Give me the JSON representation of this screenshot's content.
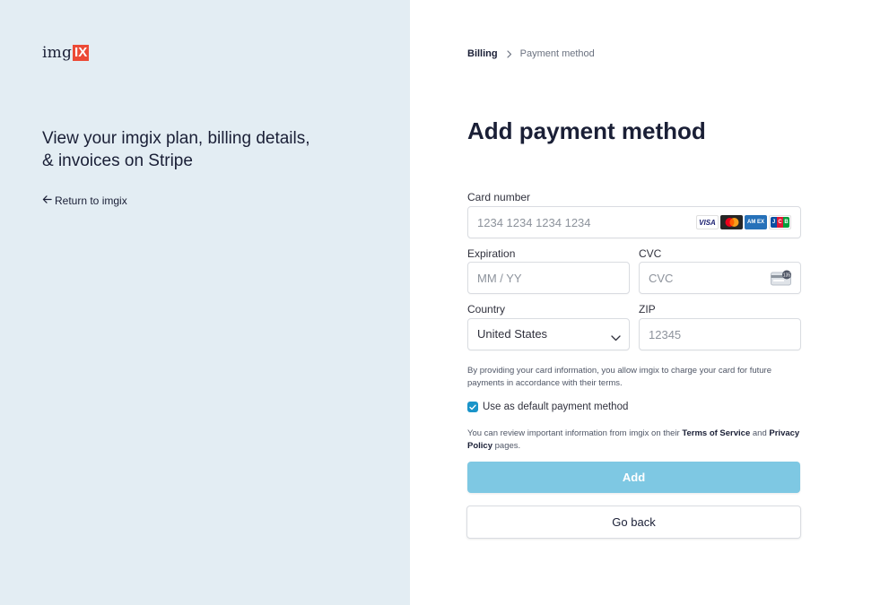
{
  "brand": {
    "logo_prefix": "img",
    "logo_suffix": "IX",
    "logo_accent": "#ec4a36"
  },
  "sidebar": {
    "tagline": "View your imgix plan, billing details, & invoices on Stripe",
    "return_link": "Return to imgix",
    "background": "#e3edf3"
  },
  "breadcrumb": {
    "parent": "Billing",
    "current": "Payment method"
  },
  "page_title": "Add payment method",
  "form": {
    "card_number": {
      "label": "Card number",
      "placeholder": "1234 1234 1234 1234",
      "value": "",
      "brands": [
        "visa",
        "mastercard",
        "amex",
        "jcb"
      ]
    },
    "expiration": {
      "label": "Expiration",
      "placeholder": "MM / YY",
      "value": ""
    },
    "cvc": {
      "label": "CVC",
      "placeholder": "CVC",
      "value": "",
      "icon_text": "135"
    },
    "country": {
      "label": "Country",
      "value": "United States"
    },
    "zip": {
      "label": "ZIP",
      "placeholder": "12345",
      "value": ""
    }
  },
  "consent_text": "By providing your card information, you allow imgix to charge your card for future payments in accordance with their terms.",
  "default_checkbox": {
    "label": "Use as default payment method",
    "checked": true
  },
  "info": {
    "prefix": "You can review important information from imgix on their ",
    "terms": "Terms of Service",
    "and": " and ",
    "privacy": "Privacy Policy",
    "suffix": " pages."
  },
  "buttons": {
    "add": "Add",
    "back": "Go back",
    "add_color": "#7ec8e3"
  }
}
